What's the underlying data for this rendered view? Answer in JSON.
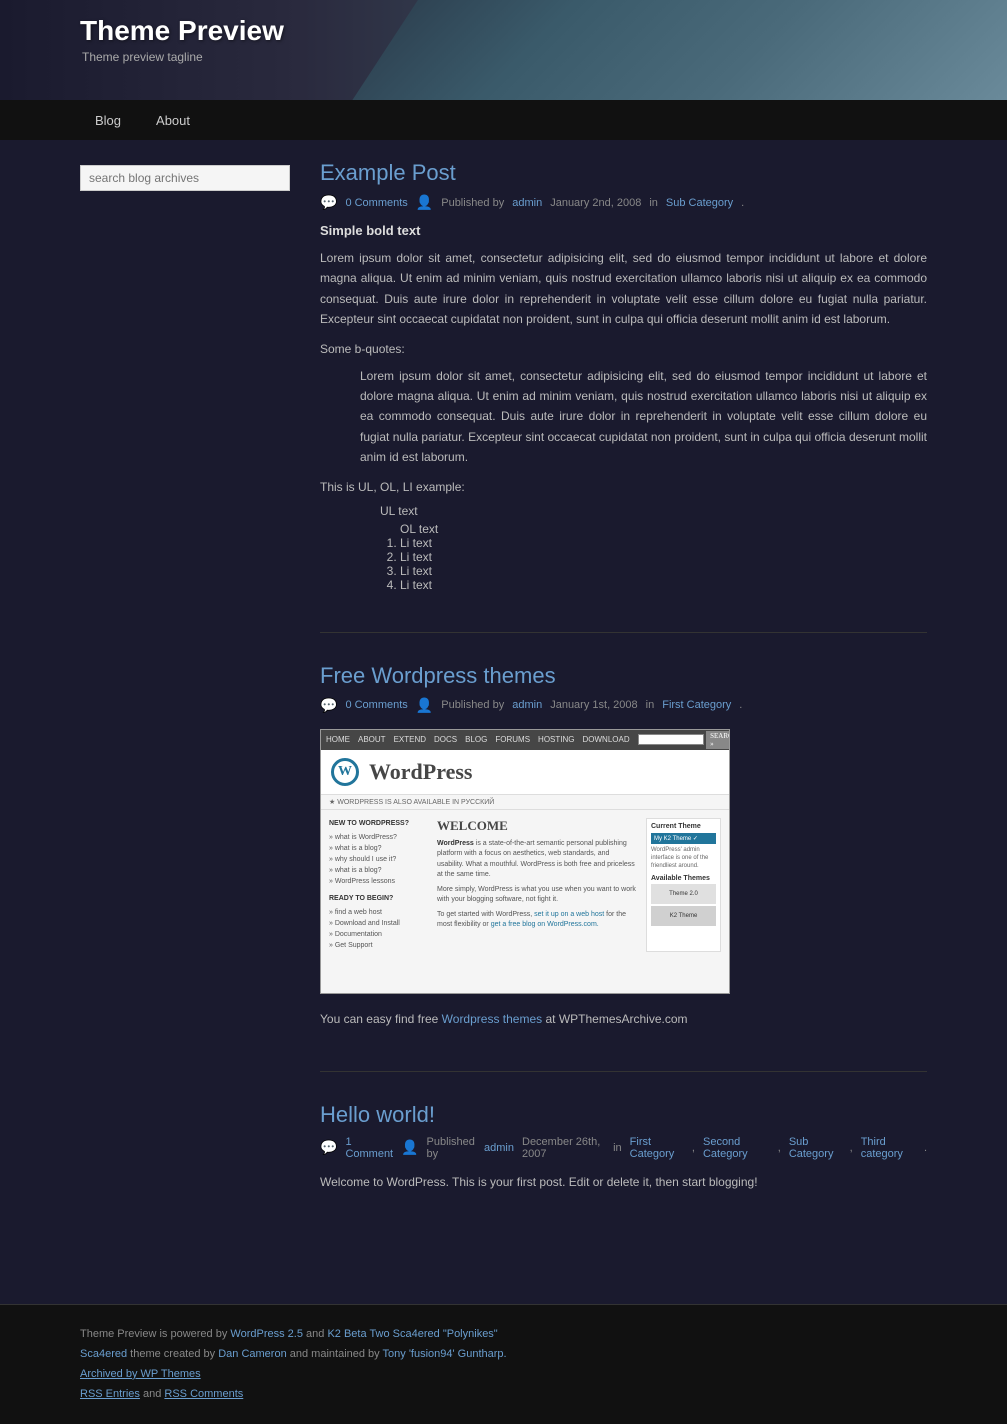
{
  "site": {
    "title": "Theme Preview",
    "tagline": "Theme preview tagline"
  },
  "nav": {
    "items": [
      {
        "label": "Blog",
        "url": "#"
      },
      {
        "label": "About",
        "url": "#"
      }
    ]
  },
  "sidebar": {
    "search_placeholder": "search blog archives"
  },
  "posts": [
    {
      "title": "Example Post",
      "comments": "0 Comments",
      "published_by": "Published by",
      "author": "admin",
      "date": "January 2nd, 2008",
      "in_label": "in",
      "category": "Sub Category",
      "subtitle": "Simple bold text",
      "body": "Lorem ipsum dolor sit amet, consectetur adipisicing elit, sed do eiusmod tempor incididunt ut labore et dolore magna aliqua. Ut enim ad minim veniam, quis nostrud exercitation ullamco laboris nisi ut aliquip ex ea commodo consequat. Duis aute irure dolor in reprehenderit in voluptate velit esse cillum dolore eu fugiat nulla pariatur. Excepteur sint occaecat cupidatat non proident, sunt in culpa qui officia deserunt mollit anim id est laborum.",
      "bquote_label": "Some b-quotes:",
      "blockquote": "Lorem ipsum dolor sit amet, consectetur adipisicing elit, sed do eiusmod tempor incididunt ut labore et dolore magna aliqua. Ut enim ad minim veniam, quis nostrud exercitation ullamco laboris nisi ut aliquip ex ea commodo consequat. Duis aute irure dolor in reprehenderit in voluptate velit esse cillum dolore eu fugiat nulla pariatur. Excepteur sint occaecat cupidatat non proident, sunt in culpa qui officia deserunt mollit anim id est laborum.",
      "list_label": "This is UL, OL, LI example:",
      "ul_text": "UL text",
      "ol_text": "OL text",
      "li_items": [
        "Li text",
        "Li text",
        "Li text",
        "Li text"
      ]
    },
    {
      "title": "Free Wordpress themes",
      "comments": "0 Comments",
      "published_by": "Published by",
      "author": "admin",
      "date": "January 1st, 2008",
      "in_label": "in",
      "category": "First Category",
      "body_prefix": "You can easy find free",
      "link_text": "Wordpress themes",
      "body_suffix": "at WPThemesArchive.com",
      "wp_nav": [
        "HOME",
        "ABOUT",
        "EXTEND",
        "DOCS",
        "BLOG",
        "FORUMS",
        "HOSTING",
        "DOWNLOAD"
      ],
      "wp_notice": "★ WORDPRESS IS ALSO AVAILABLE IN РУССКИЙ",
      "wp_welcome": "WELCOME",
      "wp_body": "WordPress is a state-of-the-art semantic personal publishing platform with a focus on aesthetics, web standards, and usability. What a mouthful. WordPress is both free and priceless at the same time.",
      "wp_body2": "More simply, WordPress is what you use when you want to work with your blogging software, not fight it.",
      "wp_cta": "To get started with WordPress, set it up on a web host for the most flexibility or get a free blog on WordPress.com.",
      "wp_sidebar_title": "Current Theme",
      "wp_left_items": [
        "» what is WordPress?",
        "» what is a blog?",
        "» why should I use it?",
        "» what is a blog?",
        "» WordPress lessons"
      ],
      "wp_ready": "READY TO BEGIN?",
      "wp_ready_items": [
        "» find a web host",
        "» Download and Install",
        "» Documentation",
        "» Get Support"
      ]
    },
    {
      "title": "Hello world!",
      "comments": "1 Comment",
      "published_by": "Published by",
      "author": "admin",
      "date": "December 26th, 2007",
      "in_label": "in",
      "categories": [
        "First Category",
        "Second Category",
        "Sub Category",
        "Third category"
      ],
      "body": "Welcome to WordPress. This is your first post. Edit or delete it, then start blogging!"
    }
  ],
  "footer": {
    "powered_by": "Theme Preview is powered by",
    "wp_version": "WordPress 2.5",
    "and": "and",
    "theme_name": "K2 Beta Two Sca4ered \"Polynikes\"",
    "sca4ered": "Sca4ered",
    "theme_by": "theme created by",
    "author1": "Dan Cameron",
    "maintained_by": "and maintained by",
    "author2": "Tony 'fusion94' Guntharp.",
    "archived_by": "Archived by WP Themes",
    "rss_entries": "RSS Entries",
    "and_text": "and",
    "rss_comments": "RSS Comments"
  }
}
